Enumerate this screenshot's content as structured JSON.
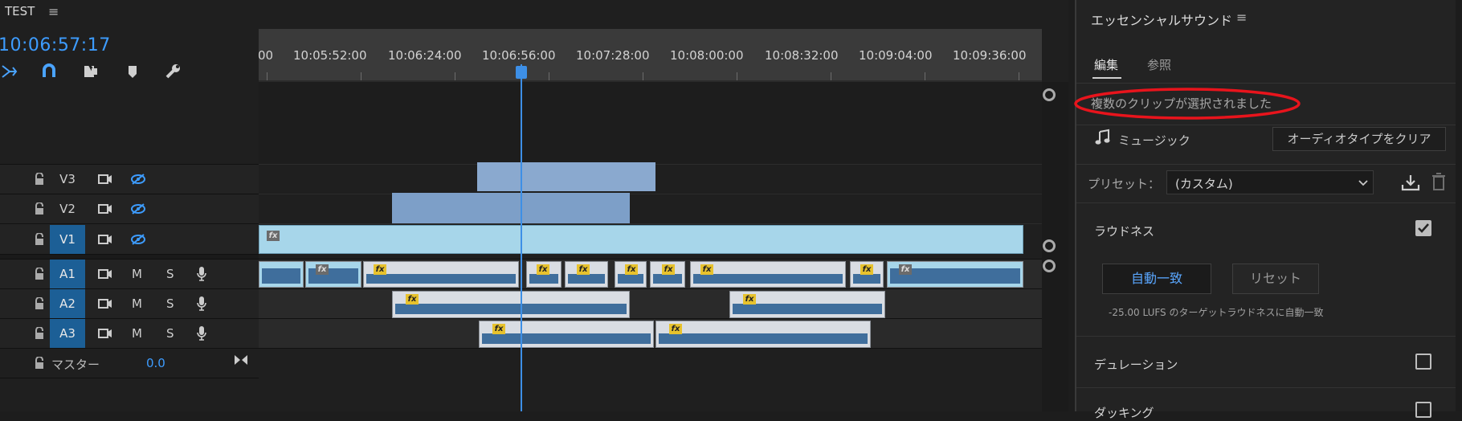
{
  "sequence": {
    "title": "TEST",
    "menu": "≡",
    "timecode": "10:06:57:17"
  },
  "toolbar": {
    "icons": [
      "ripple-icon",
      "magnet-icon",
      "linked-selection-icon",
      "marker-icon",
      "wrench-icon"
    ]
  },
  "ruler": {
    "labels": [
      "00",
      "10:05:52:00",
      "10:06:24:00",
      "10:06:56:00",
      "10:07:28:00",
      "10:08:00:00",
      "10:08:32:00",
      "10:09:04:00",
      "10:09:36:00"
    ]
  },
  "tracks": {
    "video": [
      {
        "name": "V3"
      },
      {
        "name": "V2"
      },
      {
        "name": "V1"
      }
    ],
    "audio": [
      {
        "name": "A1",
        "m": "M",
        "s": "S"
      },
      {
        "name": "A2",
        "m": "M",
        "s": "S"
      },
      {
        "name": "A3",
        "m": "M",
        "s": "S"
      }
    ],
    "master": {
      "label": "マスター",
      "value": "0.0"
    }
  },
  "clip_fx_label": "fx",
  "panel": {
    "title": "エッセンシャルサウンド",
    "menu": "≡",
    "tabs": [
      "編集",
      "参照"
    ],
    "status": "複数のクリップが選択されました",
    "audio_type": "ミュージック",
    "clear_button": "オーディオタイプをクリア",
    "preset_label": "プリセット：",
    "preset_value": "(カスタム)",
    "loudness": {
      "title": "ラウドネス",
      "checked": true,
      "auto_button": "自動一致",
      "reset_button": "リセット",
      "info": "-25.00  LUFS のターゲットラウドネスに自動一致"
    },
    "duration": {
      "title": "デュレーション",
      "checked": false
    },
    "ducking": {
      "title": "ダッキング"
    }
  },
  "colors": {
    "accent": "#3d9cff",
    "annotation": "#e8141c",
    "track_on": "#1c5f96",
    "fx_badge": "#e7c22d"
  }
}
